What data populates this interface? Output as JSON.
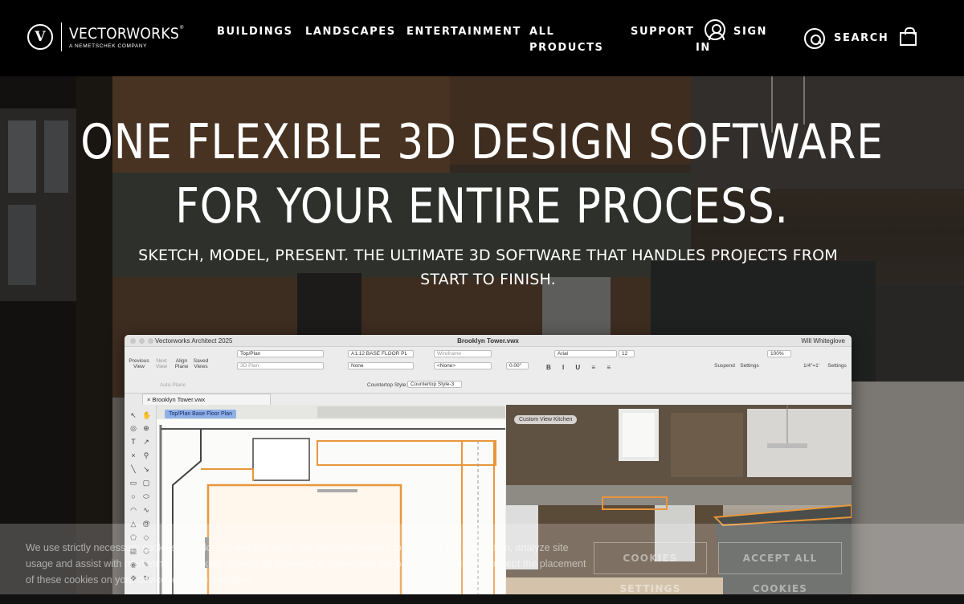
{
  "brand": {
    "name": "VECTORWORKS",
    "tagline": "A NEMETSCHEK COMPANY",
    "mark": "V",
    "registered": "®"
  },
  "nav": {
    "items": [
      "BUILDINGS",
      "LANDSCAPES",
      "ENTERTAINMENT",
      "ALL PRODUCTS",
      "SUPPORT"
    ],
    "sign_in": "SIGN IN",
    "search": "SEARCH"
  },
  "hero": {
    "headline_1": "ONE FLEXIBLE 3D DESIGN SOFTWARE",
    "headline_2": "FOR YOUR ENTIRE PROCESS.",
    "subheadline": "SKETCH, MODEL, PRESENT. THE ULTIMATE 3D SOFTWARE THAT HANDLES PROJECTS FROM START TO FINISH."
  },
  "app": {
    "app_name": "Vectorworks Architect 2025",
    "file_name": "Brooklyn Tower.vwx",
    "user": "Will Whiteglove",
    "doc_tab": "× Brooklyn Tower.vwx",
    "toolbar": {
      "previous_view": "Previous View",
      "next_view": "Next View",
      "align_plane": "Align Plane",
      "saved_views": "Saved Views",
      "view_field": "Top/Plan",
      "render_field": "3D Plan",
      "layer_field": "A1.12 BASE FLOOR PL",
      "class_field": "None",
      "render_mode": "Wireframe",
      "none_field": "<None>",
      "offset_field": "0.00\"",
      "font_field": "Arial",
      "font_size": "12",
      "zoom": "100%",
      "scale": "1/4\"=1'",
      "suspend": "Suspend",
      "settings": "Settings",
      "settings_2": "Settings",
      "auto_plane": "Auto-Plane",
      "countertop_label": "Countertop Style:",
      "countertop_value": "Countertop Style-3"
    },
    "plan_label": "Top/Plan Base Floor Plan",
    "render_label": "Custom View Kitchen"
  },
  "cookie": {
    "text": "We use strictly necessary cookies to make our website work. We also use cookies to enhance site navigation, analyze site usage and assist with marketing. By clicking \"Accept All Cookies\" or dismissing the banner, you agree to accept the placement of these cookies on your device for these purposes.",
    "settings_button": "COOKIES SETTINGS",
    "accept_button": "ACCEPT ALL COOKIES"
  },
  "colors": {
    "nav_bg": "#000000",
    "plan_accent": "#e8963c",
    "plan_label_bg": "#8fb0e6"
  }
}
